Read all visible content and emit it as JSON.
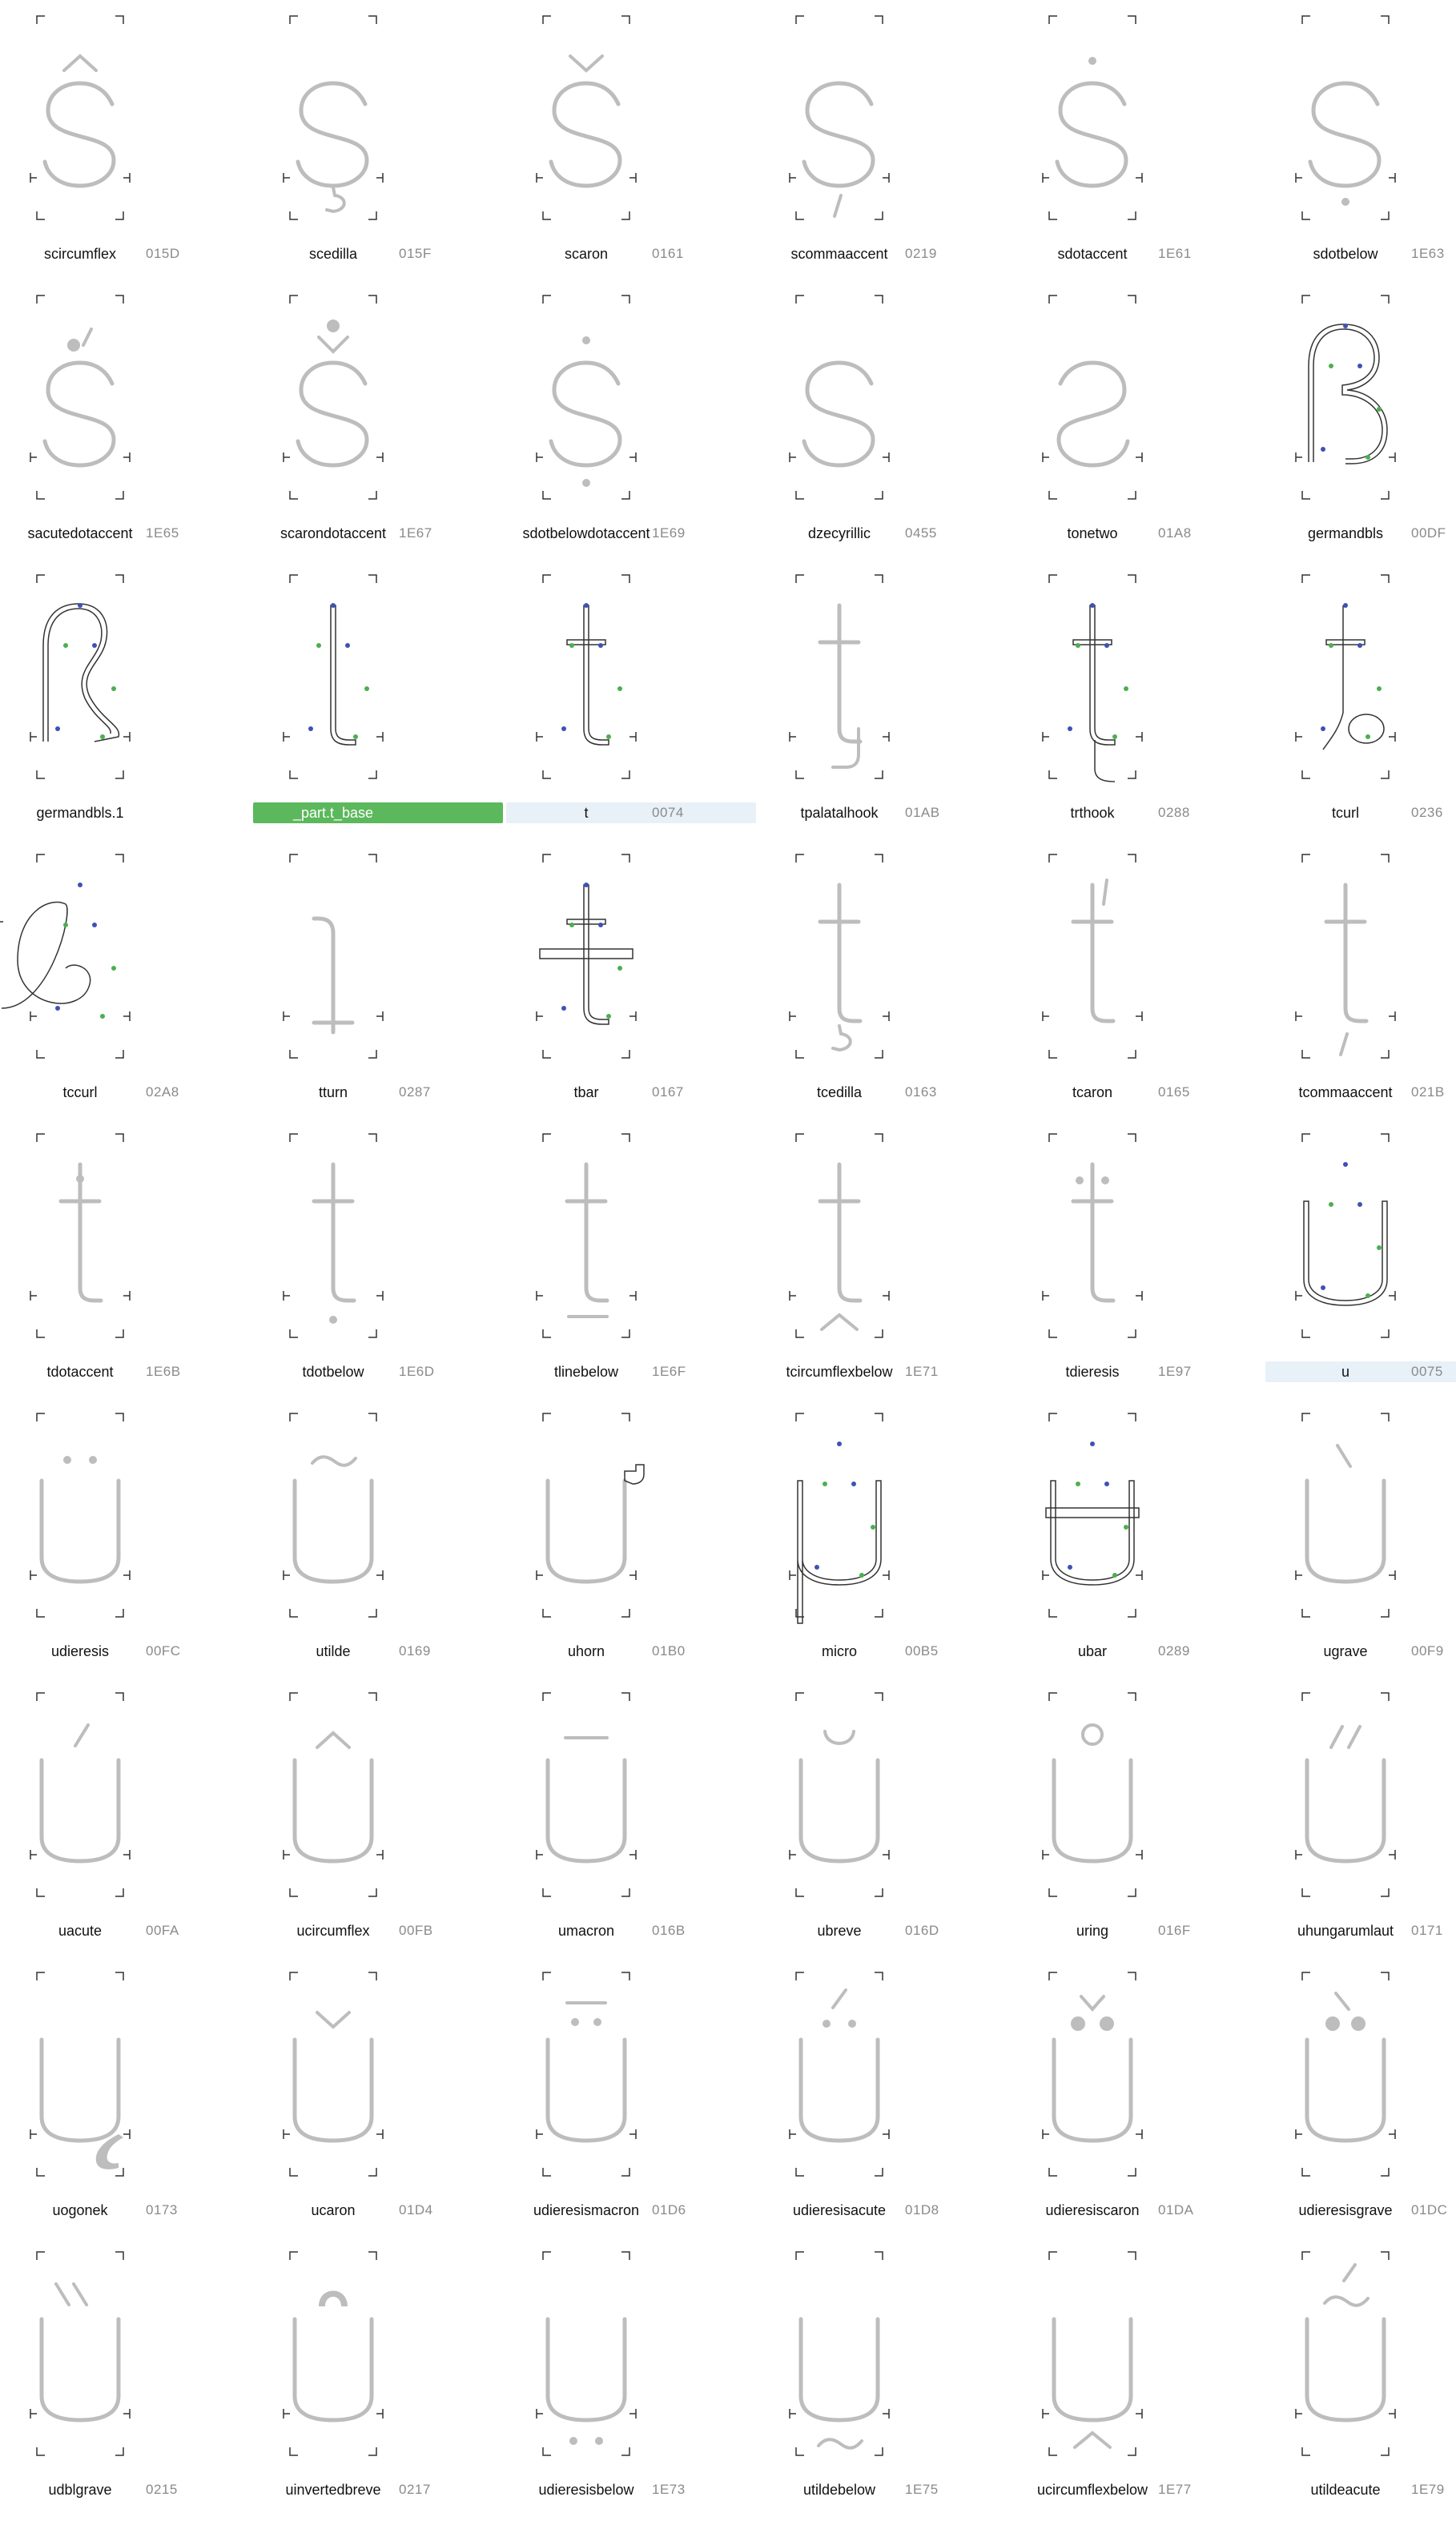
{
  "colors": {
    "glyph_gray": "#bdbdbd",
    "outline": "#333333",
    "node_green": "#4caf50",
    "node_blue": "#3f51b5",
    "selected_blue": "#e8f0f8",
    "selected_green": "#5cb85c",
    "label_text": "#111111",
    "code_text": "#8a8a8a"
  },
  "glyphs": [
    {
      "name": "scircumflex",
      "code": "015D",
      "base": "s",
      "mark": "circumflex"
    },
    {
      "name": "scedilla",
      "code": "015F",
      "base": "s",
      "mark": "cedilla"
    },
    {
      "name": "scaron",
      "code": "0161",
      "base": "s",
      "mark": "caron"
    },
    {
      "name": "scommaaccent",
      "code": "0219",
      "base": "s",
      "mark": "commabelow"
    },
    {
      "name": "sdotaccent",
      "code": "1E61",
      "base": "s",
      "mark": "dotabove"
    },
    {
      "name": "sdotbelow",
      "code": "1E63",
      "base": "s",
      "mark": "dotbelow"
    },
    {
      "name": "sacutedotaccent",
      "code": "1E65",
      "base": "s",
      "mark": "acutedot"
    },
    {
      "name": "scarondotaccent",
      "code": "1E67",
      "base": "s",
      "mark": "carondot"
    },
    {
      "name": "sdotbelowdotaccent",
      "code": "1E69",
      "base": "s",
      "mark": "dotabovebelow"
    },
    {
      "name": "dzecyrillic",
      "code": "0455",
      "base": "s",
      "mark": "none"
    },
    {
      "name": "tonetwo",
      "code": "01A8",
      "base": "s-rev",
      "mark": "none"
    },
    {
      "name": "germandbls",
      "code": "00DF",
      "base": "germandbls",
      "mark": "none",
      "edit": true
    },
    {
      "name": "germandbls.1",
      "code": "",
      "base": "germandbls1",
      "mark": "none",
      "edit": true
    },
    {
      "name": "_part.t_base",
      "code": "",
      "base": "t-stem",
      "mark": "none",
      "edit": true,
      "selected": "green"
    },
    {
      "name": "t",
      "code": "0074",
      "base": "t",
      "mark": "none",
      "edit": true,
      "selected": "blue"
    },
    {
      "name": "tpalatalhook",
      "code": "01AB",
      "base": "t",
      "mark": "palatalhook"
    },
    {
      "name": "trthook",
      "code": "0288",
      "base": "t-long",
      "mark": "none",
      "edit": true
    },
    {
      "name": "tcurl",
      "code": "0236",
      "base": "tcurl",
      "mark": "none",
      "edit": true
    },
    {
      "name": "tccurl",
      "code": "02A8",
      "base": "tccurl",
      "mark": "none",
      "edit": true
    },
    {
      "name": "tturn",
      "code": "0287",
      "base": "tturn",
      "mark": "none"
    },
    {
      "name": "tbar",
      "code": "0167",
      "base": "t",
      "mark": "bar",
      "edit": true
    },
    {
      "name": "tcedilla",
      "code": "0163",
      "base": "t",
      "mark": "cedilla"
    },
    {
      "name": "tcaron",
      "code": "0165",
      "base": "t",
      "mark": "caronapostrophe"
    },
    {
      "name": "tcommaaccent",
      "code": "021B",
      "base": "t",
      "mark": "commabelow"
    },
    {
      "name": "tdotaccent",
      "code": "1E6B",
      "base": "t",
      "mark": "dotabove"
    },
    {
      "name": "tdotbelow",
      "code": "1E6D",
      "base": "t",
      "mark": "dotbelow"
    },
    {
      "name": "tlinebelow",
      "code": "1E6F",
      "base": "t",
      "mark": "linebelow"
    },
    {
      "name": "tcircumflexbelow",
      "code": "1E71",
      "base": "t",
      "mark": "circumflexbelow"
    },
    {
      "name": "tdieresis",
      "code": "1E97",
      "base": "t",
      "mark": "dieresis"
    },
    {
      "name": "u",
      "code": "0075",
      "base": "u",
      "mark": "none",
      "edit": true,
      "selected": "blue"
    },
    {
      "name": "udieresis",
      "code": "00FC",
      "base": "u",
      "mark": "dieresis"
    },
    {
      "name": "utilde",
      "code": "0169",
      "base": "u",
      "mark": "tilde"
    },
    {
      "name": "uhorn",
      "code": "01B0",
      "base": "u",
      "mark": "horn"
    },
    {
      "name": "micro",
      "code": "00B5",
      "base": "micro",
      "mark": "none",
      "edit": true
    },
    {
      "name": "ubar",
      "code": "0289",
      "base": "u",
      "mark": "bar",
      "edit": true
    },
    {
      "name": "ugrave",
      "code": "00F9",
      "base": "u",
      "mark": "grave"
    },
    {
      "name": "uacute",
      "code": "00FA",
      "base": "u",
      "mark": "acute"
    },
    {
      "name": "ucircumflex",
      "code": "00FB",
      "base": "u",
      "mark": "circumflex"
    },
    {
      "name": "umacron",
      "code": "016B",
      "base": "u",
      "mark": "macron"
    },
    {
      "name": "ubreve",
      "code": "016D",
      "base": "u",
      "mark": "breve"
    },
    {
      "name": "uring",
      "code": "016F",
      "base": "u",
      "mark": "ring"
    },
    {
      "name": "uhungarumlaut",
      "code": "0171",
      "base": "u",
      "mark": "hungarumlaut"
    },
    {
      "name": "uogonek",
      "code": "0173",
      "base": "u",
      "mark": "ogonek"
    },
    {
      "name": "ucaron",
      "code": "01D4",
      "base": "u",
      "mark": "caron"
    },
    {
      "name": "udieresismacron",
      "code": "01D6",
      "base": "u",
      "mark": "dieresismacron"
    },
    {
      "name": "udieresisacute",
      "code": "01D8",
      "base": "u",
      "mark": "dieresisacute"
    },
    {
      "name": "udieresiscaron",
      "code": "01DA",
      "base": "u",
      "mark": "dieresiscaron"
    },
    {
      "name": "udieresisgrave",
      "code": "01DC",
      "base": "u",
      "mark": "dieresisgrave"
    },
    {
      "name": "udblgrave",
      "code": "0215",
      "base": "u",
      "mark": "dblgrave"
    },
    {
      "name": "uinvertedbreve",
      "code": "0217",
      "base": "u",
      "mark": "invertedbreve"
    },
    {
      "name": "udieresisbelow",
      "code": "1E73",
      "base": "u",
      "mark": "dieresisbelow"
    },
    {
      "name": "utildebelow",
      "code": "1E75",
      "base": "u",
      "mark": "tildebelow"
    },
    {
      "name": "ucircumflexbelow",
      "code": "1E77",
      "base": "u",
      "mark": "circumflexbelow"
    },
    {
      "name": "utildeacute",
      "code": "1E79",
      "base": "u",
      "mark": "tildeacute"
    }
  ]
}
